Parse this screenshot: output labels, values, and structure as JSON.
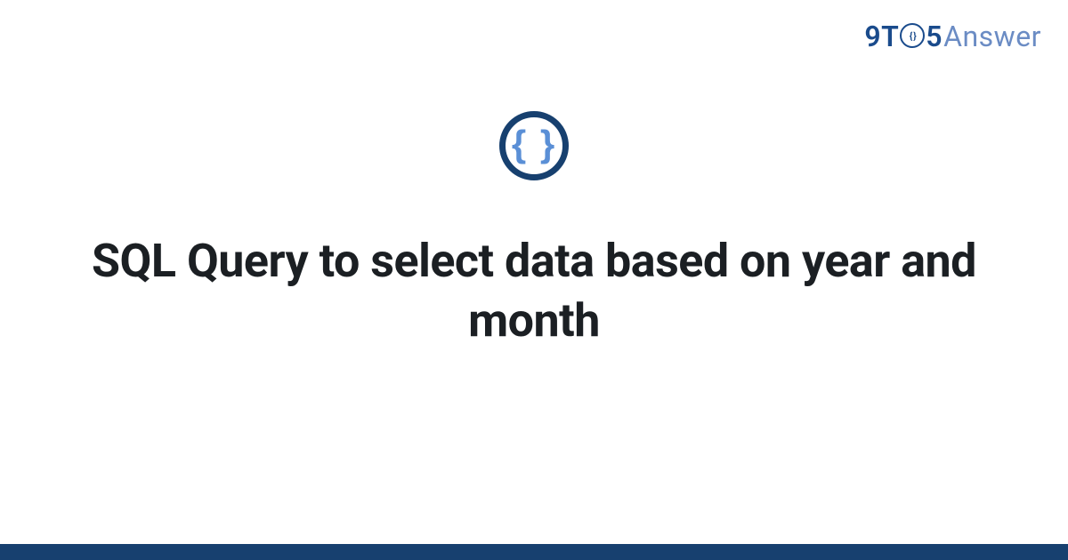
{
  "brand": {
    "prefix_9": "9",
    "letter_t": "T",
    "o_inner": "{ }",
    "suffix_5": "5",
    "answer": "Answer"
  },
  "icon": {
    "braces": "{ }",
    "name": "code-braces-icon"
  },
  "title": "SQL Query to select data based on year and month",
  "colors": {
    "brand_primary": "#1a4b8c",
    "brand_light": "#6b8cc4",
    "icon_ring": "#17406f",
    "icon_glyph": "#5a8fd6",
    "footer": "#17406f",
    "title_text": "#1b1f23"
  }
}
